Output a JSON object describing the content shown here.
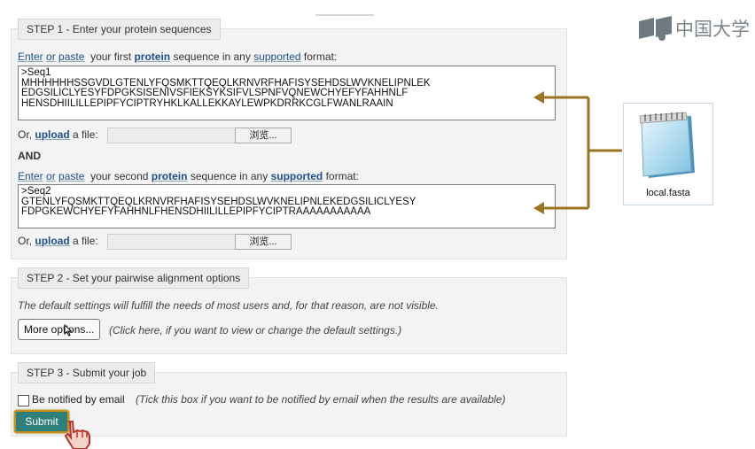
{
  "step1": {
    "title": "STEP 1 - Enter your protein sequences",
    "seq1": {
      "intro_enter": "Enter",
      "intro_or": "or",
      "intro_paste": "paste",
      "intro_rest1": "your first",
      "intro_protein": "protein",
      "intro_rest2": "sequence in any",
      "intro_supported": "supported",
      "intro_rest3": "format:",
      "text": ">Seq1\nMHHHHHHSSGVDLGTENLYFQSMKTTQEQLKRNVRFHAFISYSEHDSLWVKNELIPNLEK\nEDGSILICLYESYFDPGKSISENIVSFIEKSYKSIFVLSPNFVQNEWCHYEFYFAHHNLF\nHENSDHIILILLEPIPFYCIPTRYHKLKALLEKKAYLEWPKDRRKCGLFWANLRAAIN"
    },
    "upload1": {
      "or": "Or,",
      "upload": "upload",
      "a_file": "a file:",
      "browse": "浏览..."
    },
    "and": "AND",
    "seq2": {
      "intro_enter": "Enter",
      "intro_or": "or",
      "intro_paste": "paste",
      "intro_rest1": "your second",
      "intro_protein": "protein",
      "intro_rest2": "sequence in any",
      "intro_supported": "supported",
      "intro_rest3": "format:",
      "text": ">Seq2\nGTENLYFQSMKTTQEQLKRNVRFHAFISYSEHDSLWVKNELIPNLEKEDGSILICLYESY\nFDPGKEWCHYEFYFAHHNLFHENSDHIILILLEPIPFYCIPTRAAAAAAAAAAA"
    },
    "upload2": {
      "or": "Or,",
      "upload": "upload",
      "a_file": "a file:",
      "browse": "浏览..."
    }
  },
  "step2": {
    "title": "STEP 2 - Set your pairwise alignment options",
    "note": "The default settings will fulfill the needs of most users and, for that reason, are not visible.",
    "more_options": "More options...",
    "more_hint": "(Click here, if you want to view or change the default settings.)"
  },
  "step3": {
    "title": "STEP 3 - Submit your job",
    "notify_label": "Be notified by email",
    "notify_hint": "(Tick this box if you want to be notified by email when the results are available)",
    "submit": "Submit"
  },
  "overlay": {
    "file_name": "local.fasta",
    "watermark": "中国大学"
  },
  "colors": {
    "arrow": "#9a7420",
    "submit_bg": "#2f7f7a",
    "submit_border": "#c99214"
  },
  "icons": [
    "notepad-file-icon",
    "hand-pointer-icon",
    "arrow-left-icon",
    "mooc-logo-icon"
  ]
}
